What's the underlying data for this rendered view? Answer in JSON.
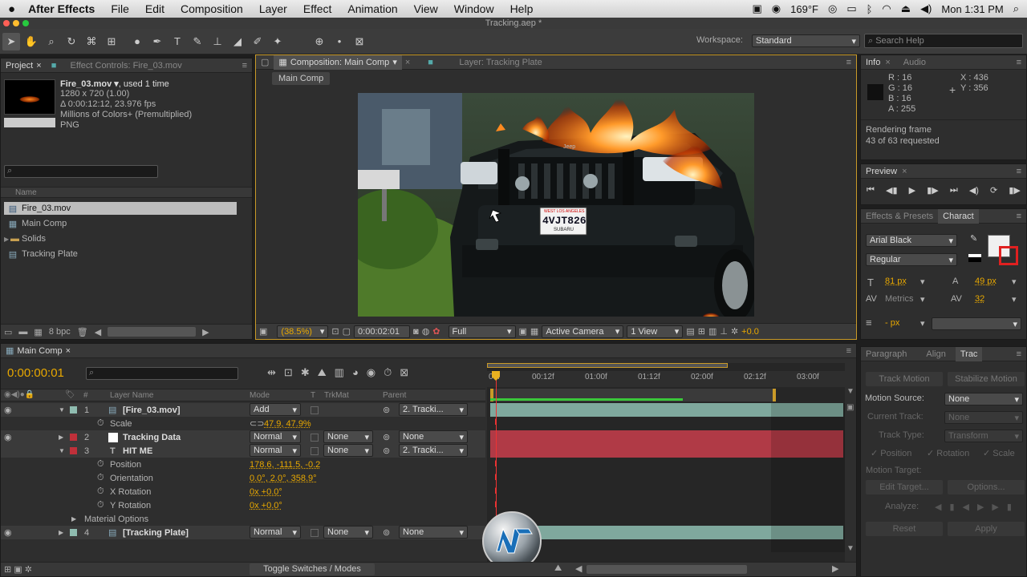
{
  "menubar": {
    "app": "After Effects",
    "items": [
      "File",
      "Edit",
      "Composition",
      "Layer",
      "Effect",
      "Animation",
      "View",
      "Window",
      "Help"
    ],
    "temp": "169°F",
    "clock": "Mon 1:31 PM"
  },
  "window_title": "Tracking.aep *",
  "workspace": {
    "label": "Workspace:",
    "value": "Standard"
  },
  "search_help": {
    "placeholder": "Search Help"
  },
  "project": {
    "tabs": [
      "Project",
      "Effect Controls: Fire_03.mov"
    ],
    "file_name": "Fire_03.mov ▾",
    "used": ", used 1 time",
    "info": [
      "1280 x 720 (1.00)",
      "Δ 0:00:12:12, 23.976 fps",
      "Millions of Colors+ (Premultiplied)",
      "PNG"
    ],
    "col_name": "Name",
    "items": [
      {
        "name": "Fire_03.mov",
        "icon": "footage-icon",
        "selected": true
      },
      {
        "name": "Main Comp",
        "icon": "composition-icon"
      },
      {
        "name": "Solids",
        "icon": "folder-icon"
      },
      {
        "name": "Tracking Plate",
        "icon": "footage-icon"
      }
    ],
    "bpc": "8 bpc"
  },
  "composition": {
    "tab": "Composition: Main Comp",
    "layer_tab": "Layer: Tracking Plate",
    "breadcrumb": "Main Comp",
    "zoom": "(38.5%)",
    "timecode": "0:00:02:01",
    "resolution": "Full",
    "camera": "Active Camera",
    "view": "1 View",
    "exposure": "+0.0",
    "plate": "4VJT826",
    "plate_top": "WEST LOS ANGELES",
    "plate_bottom": "SUBARU",
    "jeep": "Jeep"
  },
  "info_panel": {
    "tabs": [
      "Info",
      "Audio"
    ],
    "r": "R : 16",
    "g": "G : 16",
    "b": "B : 16",
    "a": "A : 255",
    "x": "X : 436",
    "y": "Y : 356",
    "status1": "Rendering frame",
    "status2": "43 of 63 requested"
  },
  "preview": {
    "tab": "Preview"
  },
  "character": {
    "tabs": [
      "Effects & Presets",
      "Charact"
    ],
    "font": "Arial Black",
    "style": "Regular",
    "size": "81 px",
    "leading": "49 px",
    "kerning": "Metrics",
    "tracking": "32",
    "indent": "- px"
  },
  "tracker": {
    "tabs": [
      "Paragraph",
      "Align",
      "Trac"
    ],
    "track_motion": "Track Motion",
    "stabilize": "Stabilize Motion",
    "motion_source_label": "Motion Source:",
    "motion_source": "None",
    "current_track_label": "Current Track:",
    "current_track": "None",
    "track_type_label": "Track Type:",
    "track_type": "Transform",
    "position": "Position",
    "rotation": "Rotation",
    "scale": "Scale",
    "motion_target": "Motion Target:",
    "edit_target": "Edit Target...",
    "options": "Options...",
    "analyze": "Analyze:",
    "reset": "Reset",
    "apply": "Apply"
  },
  "timeline": {
    "tab": "Main Comp",
    "timecode": "0:00:00:01",
    "headers": {
      "num": "#",
      "layer": "Layer Name",
      "mode": "Mode",
      "t": "T",
      "trkmat": "TrkMat",
      "parent": "Parent"
    },
    "ruler": [
      "00f",
      "00:12f",
      "01:00f",
      "01:12f",
      "02:00f",
      "02:12f",
      "03:00f"
    ],
    "toggle": "Toggle Switches / Modes",
    "layers": [
      {
        "num": "1",
        "name": "[Fire_03.mov]",
        "mode": "Add",
        "trkmat": "",
        "parent": "2. Tracki...",
        "color": "#8fbcb0"
      },
      {
        "num": "2",
        "name": "Tracking Data",
        "mode": "Normal",
        "trkmat": "None",
        "parent": "None",
        "color": "#c0303a"
      },
      {
        "num": "3",
        "name": "HIT ME",
        "mode": "Normal",
        "trkmat": "None",
        "parent": "2. Tracki...",
        "color": "#c0303a"
      },
      {
        "num": "4",
        "name": "[Tracking Plate]",
        "mode": "Normal",
        "trkmat": "None",
        "parent": "None",
        "color": "#8fbcb0"
      }
    ],
    "props": {
      "scale_label": "Scale",
      "scale": "47.9, 47.9%",
      "position_label": "Position",
      "position": "178.6, -111.5, -0.2",
      "orientation_label": "Orientation",
      "orientation": "0.0°, 2.0°, 358.9°",
      "xrot_label": "X Rotation",
      "xrot": "0x +0.0°",
      "yrot_label": "Y Rotation",
      "yrot": "0x +0.0°",
      "material": "Material Options"
    }
  }
}
